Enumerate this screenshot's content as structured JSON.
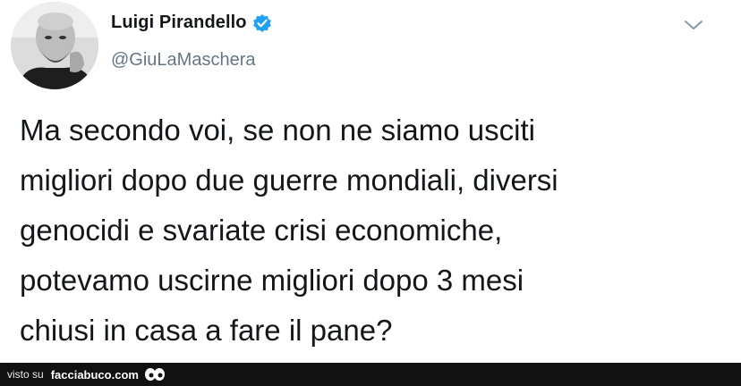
{
  "tweet": {
    "display_name": "Luigi Pirandello",
    "handle": "@GiuLaMaschera",
    "text": "Ma secondo voi, se non ne siamo usciti migliori dopo due guerre mondiali, diversi genocidi e svariate crisi economiche, potevamo uscirne migliori dopo 3 mesi chiusi in casa a fare il pane?",
    "text_lines": [
      "Ma secondo voi, se non ne siamo usciti",
      "migliori dopo due guerre mondiali, diversi",
      "genocidi e svariate crisi economiche,",
      "potevamo uscirne migliori dopo 3 mesi",
      "chiusi in casa a fare il pane?"
    ],
    "verified_icon": "verified-badge-icon",
    "menu_icon": "chevron-down-icon",
    "avatar": "avatar-photo"
  },
  "footer": {
    "visto_su": "visto su",
    "site": "facciabuco.com",
    "logo_icon": "eyes-logo-icon"
  },
  "colors": {
    "text": "#14171a",
    "handle": "#657786",
    "verified": "#1da1f2",
    "footer_bg": "#111111"
  }
}
